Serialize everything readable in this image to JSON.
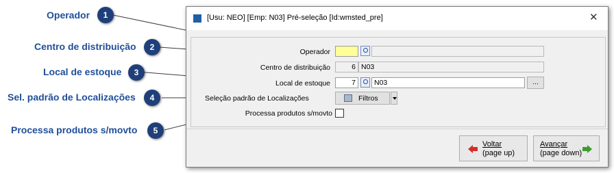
{
  "callouts": [
    {
      "num": "1",
      "label": "Operador"
    },
    {
      "num": "2",
      "label": "Centro de distribuição"
    },
    {
      "num": "3",
      "label": "Local de estoque"
    },
    {
      "num": "4",
      "label": "Sel. padrão de Localizações"
    },
    {
      "num": "5",
      "label": "Processa produtos s/movto"
    }
  ],
  "window": {
    "title": "[Usu: NEO] [Emp: N03] Pré-seleção [Id:wmsted_pre]",
    "close_icon": "close-icon"
  },
  "form": {
    "operador": {
      "label": "Operador",
      "code": "",
      "description": ""
    },
    "centro": {
      "label": "Centro de distribuição",
      "code": "6",
      "description": "N03"
    },
    "local": {
      "label": "Local de estoque",
      "code": "7",
      "description": "N03",
      "ellipsis": "..."
    },
    "selecao": {
      "label": "Seleção padrão de Localizações",
      "button": "Filtros"
    },
    "processa": {
      "label": "Processa produtos s/movto",
      "checked": false
    }
  },
  "buttons": {
    "voltar": {
      "line1": "Voltar",
      "line2": "(page up)"
    },
    "avancar": {
      "line1": "Avançar",
      "line2": "(page down)"
    }
  },
  "colors": {
    "callout": "#1f4e99",
    "badge": "#1f3f7a",
    "highlight_field": "#ffff99"
  }
}
